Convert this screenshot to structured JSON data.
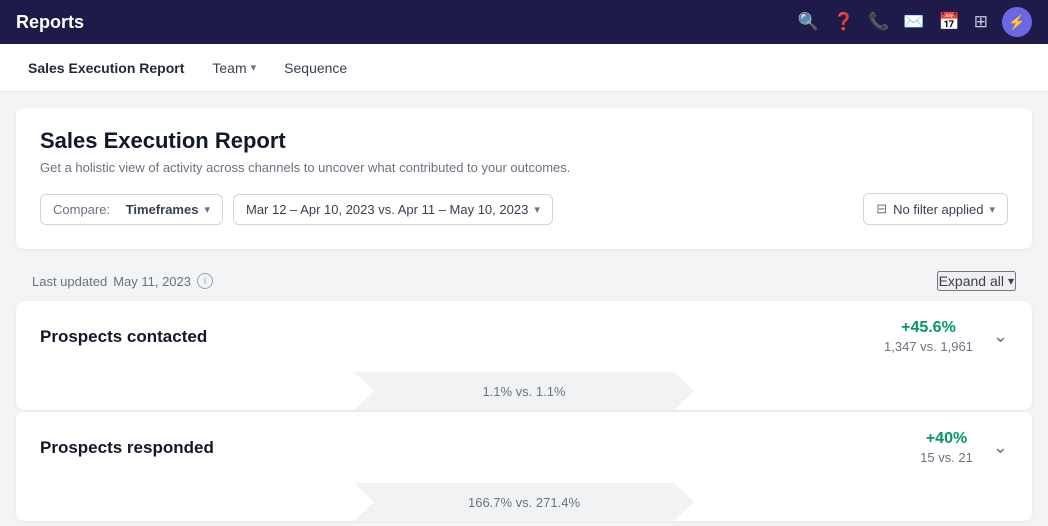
{
  "header": {
    "title": "Reports",
    "icons": [
      "search",
      "help",
      "phone",
      "mail",
      "calendar",
      "grid",
      "lightning"
    ],
    "avatar_letter": "⚡"
  },
  "nav": {
    "items": [
      {
        "label": "Sales Execution Report",
        "active": true,
        "has_chevron": false
      },
      {
        "label": "Team",
        "active": false,
        "has_chevron": true
      },
      {
        "label": "Sequence",
        "active": false,
        "has_chevron": false
      }
    ]
  },
  "report": {
    "title": "Sales Execution Report",
    "description": "Get a holistic view of activity across channels to uncover what contributed to your outcomes.",
    "compare_label": "Compare:",
    "compare_value": "Timeframes",
    "date_range": "Mar 12 – Apr 10, 2023 vs. Apr 11 – May 10, 2023",
    "filter_label": "No filter applied"
  },
  "updated_bar": {
    "prefix": "Last updated",
    "date": "May 11, 2023",
    "expand_all": "Expand all"
  },
  "metrics": [
    {
      "name": "Prospects contacted",
      "change": "+45.6%",
      "comparison": "1,347 vs. 1,961",
      "sub_text": "1.1% vs. 1.1%"
    },
    {
      "name": "Prospects responded",
      "change": "+40%",
      "comparison": "15 vs. 21",
      "sub_text": "166.7% vs. 271.4%"
    }
  ]
}
